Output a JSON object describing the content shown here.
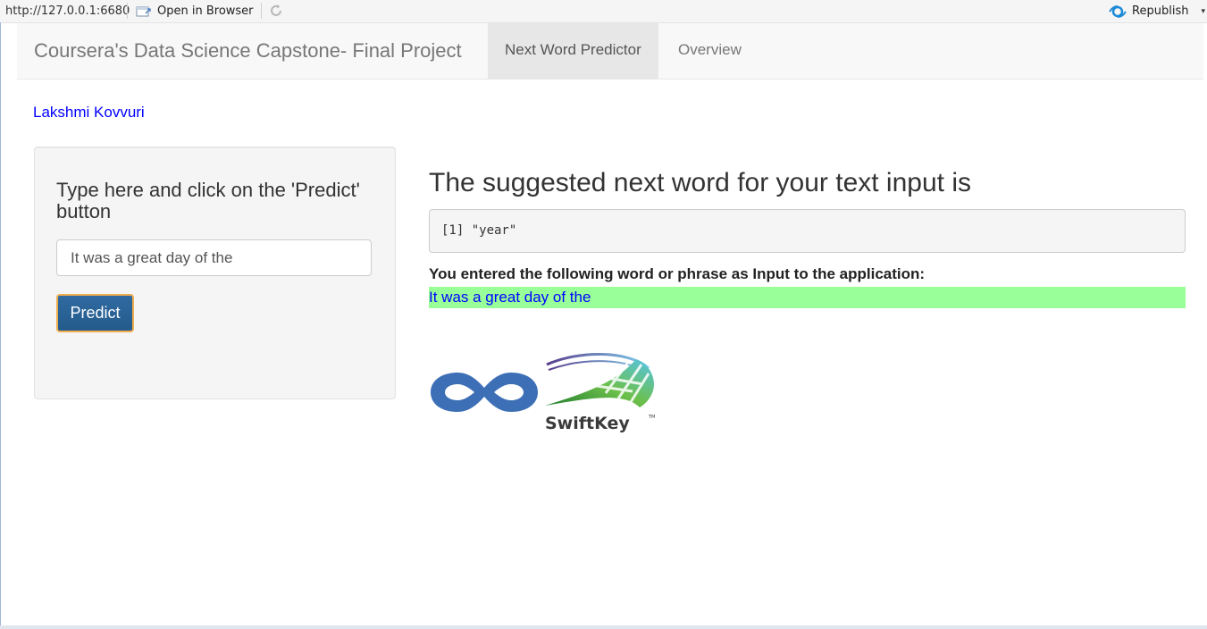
{
  "viewer": {
    "url": "http://127.0.0.1:6680",
    "open_in_browser": "Open in Browser",
    "republish": "Republish"
  },
  "navbar": {
    "brand": "Coursera's Data Science Capstone- Final Project",
    "tabs": [
      {
        "label": "Next Word Predictor",
        "active": true
      },
      {
        "label": "Overview",
        "active": false
      }
    ]
  },
  "author": "Lakshmi Kovvuri",
  "sidebar": {
    "prompt": "Type here and click on the 'Predict' button",
    "input_value": "It was a great day of the",
    "predict_label": "Predict"
  },
  "main": {
    "heading": "The suggested next word for your text input is",
    "prediction_output": "[1] \"year\"",
    "input_label": "You entered the following word or phrase as Input to the application:",
    "input_echo": "It was a great day of the"
  },
  "logos": {
    "coursera": "coursera-logo",
    "swiftkey_text": "SwiftKey"
  },
  "colors": {
    "echo_bg": "#99ff99",
    "echo_text": "#0000ff",
    "button_bg": "#2e6da4",
    "button_border": "#f0ad4e",
    "author_link": "#0000ff"
  }
}
